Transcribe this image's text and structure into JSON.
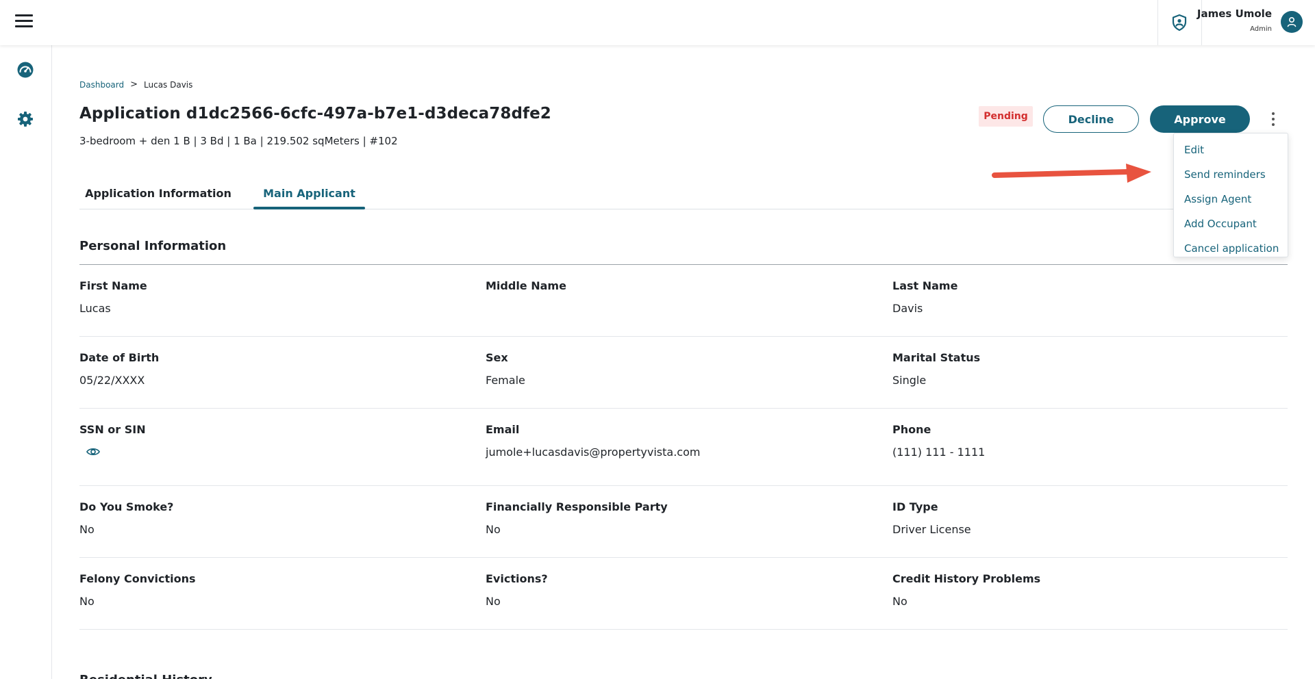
{
  "header": {
    "user_name": "James Umole",
    "user_role": "Admin",
    "icons": [
      "menu-icon",
      "shield-user-icon",
      "user-avatar-icon"
    ]
  },
  "sidebar": {
    "items": [
      {
        "icon": "dashboard-gauge-icon"
      },
      {
        "icon": "gear-icon"
      }
    ]
  },
  "breadcrumb": {
    "root": "Dashboard",
    "separator": ">",
    "current": "Lucas Davis"
  },
  "application": {
    "title": "Application d1dc2566-6cfc-497a-b7e1-d3deca78dfe2",
    "unit_summary": "3-bedroom + den 1 B | 3 Bd | 1 Ba | 219.502 sqMeters | #102",
    "status": "Pending"
  },
  "actions": {
    "decline_label": "Decline",
    "approve_label": "Approve",
    "more_icon": "more-vertical-icon"
  },
  "menu": {
    "items": [
      "Edit",
      "Send reminders",
      "Assign Agent",
      "Add Occupant",
      "Cancel application"
    ]
  },
  "tabs": [
    {
      "label": "Application Information",
      "active": false
    },
    {
      "label": "Main Applicant",
      "active": true
    }
  ],
  "personal_information": {
    "title": "Personal Information",
    "rows": [
      [
        {
          "label": "First Name",
          "value": "Lucas"
        },
        {
          "label": "Middle Name",
          "value": ""
        },
        {
          "label": "Last Name",
          "value": "Davis"
        }
      ],
      [
        {
          "label": "Date of Birth",
          "value": "05/22/XXXX"
        },
        {
          "label": "Sex",
          "value": "Female"
        },
        {
          "label": "Marital Status",
          "value": "Single"
        }
      ],
      [
        {
          "label": "SSN or SIN",
          "value": ""
        },
        {
          "label": "Email",
          "value": "jumole+lucasdavis@propertyvista.com"
        },
        {
          "label": "Phone",
          "value": "(111) 111 - 1111"
        }
      ],
      [
        {
          "label": "Do You Smoke?",
          "value": "No"
        },
        {
          "label": "Financially Responsible Party",
          "value": "No"
        },
        {
          "label": "ID Type",
          "value": "Driver License"
        }
      ],
      [
        {
          "label": "Felony Convictions",
          "value": "No"
        },
        {
          "label": "Evictions?",
          "value": "No"
        },
        {
          "label": "Credit History Problems",
          "value": "No"
        }
      ]
    ]
  },
  "next_section": {
    "title": "Residential History"
  },
  "colors": {
    "accent": "#17637a",
    "pending_text": "#d32f2f",
    "pending_bg": "#fde7e7",
    "annotation_arrow": "#e8533f"
  }
}
